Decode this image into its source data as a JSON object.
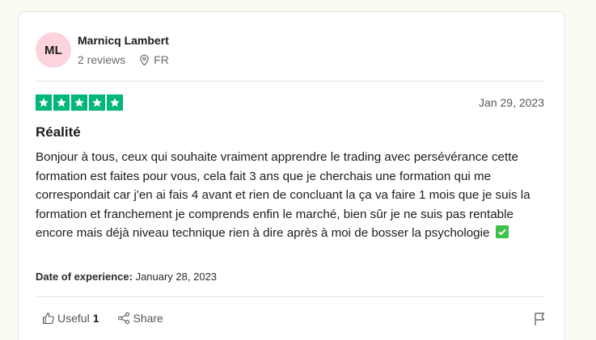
{
  "reviewer": {
    "initials": "ML",
    "name": "Marnicq Lambert",
    "reviews": "2 reviews",
    "country": "FR"
  },
  "review": {
    "rating": 5,
    "date": "Jan 29, 2023",
    "title": "Réalité",
    "body": "Bonjour à tous, ceux qui souhaite vraiment apprendre le trading avec persévérance cette formation est faites pour vous, cela fait 3 ans que je cherchais une formation qui me correspondait car j'en ai fais 4 avant et rien de concluant la ça va faire 1 mois que je suis la formation et franchement je comprends enfin le marché, bien sûr je ne suis pas rentable encore mais déjà niveau technique rien à dire après à moi de bosser la psychologie",
    "experience_label": "Date of experience:",
    "experience_date": "January 28, 2023"
  },
  "actions": {
    "useful_label": "Useful",
    "useful_count": "1",
    "share_label": "Share"
  },
  "colors": {
    "star_green": "#00b67a",
    "avatar_pink": "#fdd4dd",
    "check_green": "#3cc24a"
  }
}
